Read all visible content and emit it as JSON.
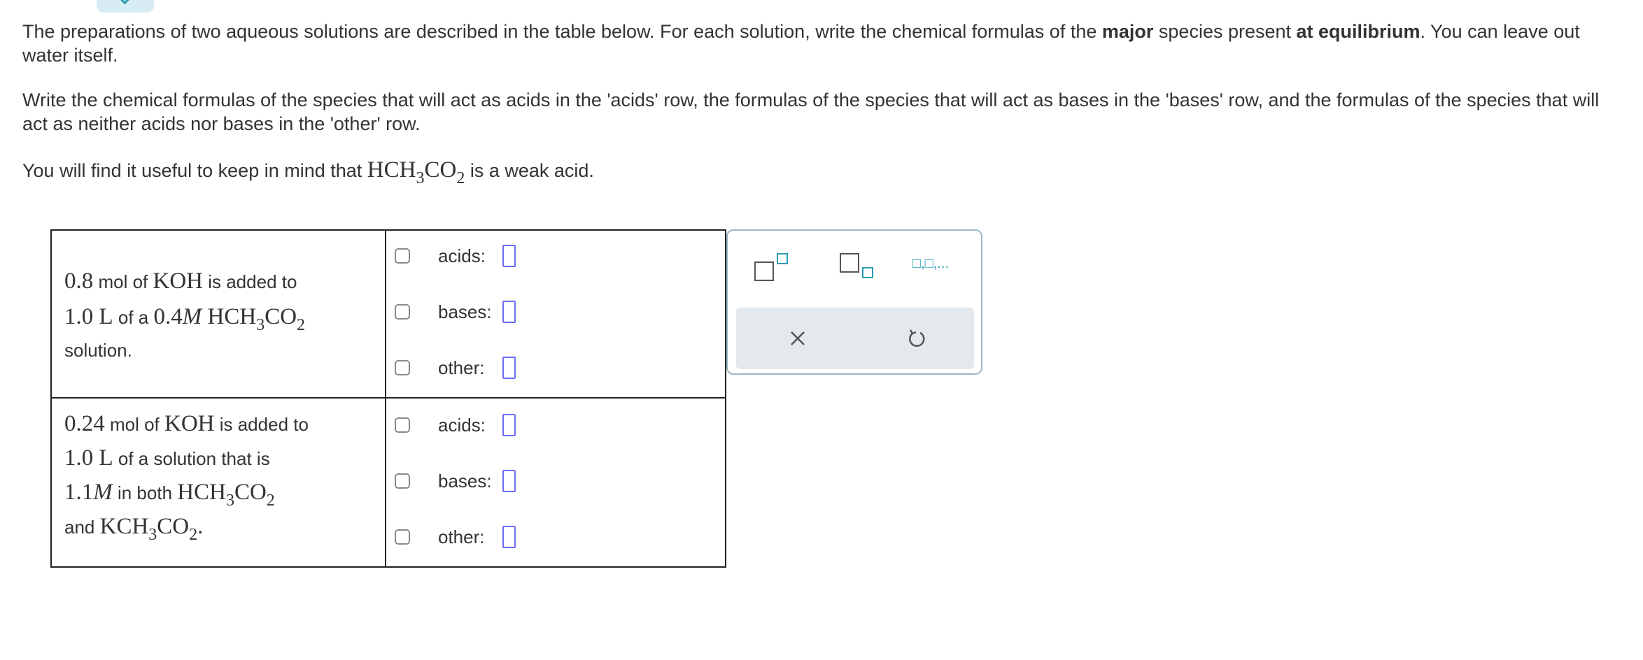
{
  "intro": {
    "p1a": "The preparations of two aqueous solutions are described in the table below. For each solution, write the chemical formulas of the ",
    "p1b": "major",
    "p1c": " species present ",
    "p1d": "at equilibrium",
    "p1e": ". You can leave out water itself.",
    "p2": "Write the chemical formulas of the species that will act as acids in the 'acids' row, the formulas of the species that will act as bases in the 'bases' row, and the formulas of the species that will act as neither acids nor bases in the 'other' row.",
    "p3a": "You will find it useful to keep in mind that ",
    "p3_formula": "HCH",
    "p3_sub1": "3",
    "p3_formula2": "CO",
    "p3_sub2": "2",
    "p3b": " is a weak acid."
  },
  "solutions": [
    {
      "amount": "0.8",
      "mol_of": " mol of ",
      "base": "KOH",
      "added_to": " is added to",
      "volume": "1.0 L",
      "of_a": " of a ",
      "conc": "0.4",
      "M": "M",
      "acid_a": " HCH",
      "acid_sub1": "3",
      "acid_b": "CO",
      "acid_sub2": "2",
      "tail": "solution."
    },
    {
      "amount": "0.24",
      "mol_of": " mol of ",
      "base": "KOH",
      "added_to": " is added to",
      "volume": "1.0 L",
      "of_a": " of a solution that is",
      "conc": "1.1",
      "M": "M",
      "in_both": " in both ",
      "acid_a": "HCH",
      "acid_sub1": "3",
      "acid_b": "CO",
      "acid_sub2": "2",
      "and": "and ",
      "salt_a": "KCH",
      "salt_sub1": "3",
      "salt_b": "CO",
      "salt_sub2": "2",
      "period": "."
    }
  ],
  "row_labels": {
    "acids": "acids:",
    "bases": "bases:",
    "other": "other:"
  },
  "palette": {
    "buttons": [
      "superscript-template",
      "subscript-template",
      "list-template"
    ],
    "list_label": "□,□,...",
    "actions": [
      "clear",
      "undo"
    ]
  },
  "colors": {
    "accent": "#2a9db3",
    "answer_box": "#6c6ef0",
    "action_bg": "#e3e9ec"
  }
}
